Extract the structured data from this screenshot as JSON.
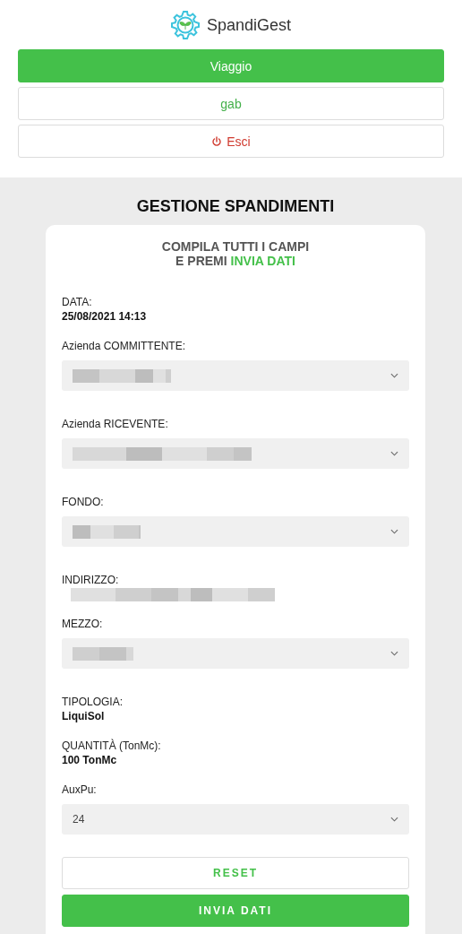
{
  "app": {
    "name": "SpandiGest"
  },
  "menu": [
    {
      "label": "Viaggio",
      "kind": "primary"
    },
    {
      "label": "gab",
      "kind": "user"
    },
    {
      "label": "Esci",
      "kind": "logout"
    }
  ],
  "page_title": "GESTIONE SPANDIMENTI",
  "card": {
    "instruction_line_1": "COMPILA TUTTI I CAMPI",
    "instruction_line_2": "E PREMI **INVIA DATI**",
    "fields": [
      {
        "kind": "text",
        "label": "DATA:",
        "value": "25/08/2021 14:13"
      },
      {
        "kind": "select",
        "label": "Azienda COMMITTENTE:",
        "redacted": true
      },
      {
        "kind": "select",
        "label": "Azienda RICEVENTE:",
        "redacted": true
      },
      {
        "kind": "select",
        "label": "FONDO:",
        "redacted": true
      },
      {
        "kind": "text",
        "label": "INDIRIZZO:",
        "redacted": true
      },
      {
        "kind": "select",
        "label": "MEZZO:",
        "redacted": true
      },
      {
        "kind": "text",
        "label": "TIPOLOGIA:",
        "value": "LiquiSol"
      },
      {
        "kind": "text",
        "label": "QUANTITÀ (TonMc):",
        "value": "100 TonMc"
      },
      {
        "kind": "select",
        "label": "AuxPu:",
        "value": "24"
      }
    ],
    "buttons": [
      {
        "label": "RESET",
        "kind": "outline"
      },
      {
        "label": "INVIA DATI",
        "kind": "primary"
      }
    ]
  }
}
